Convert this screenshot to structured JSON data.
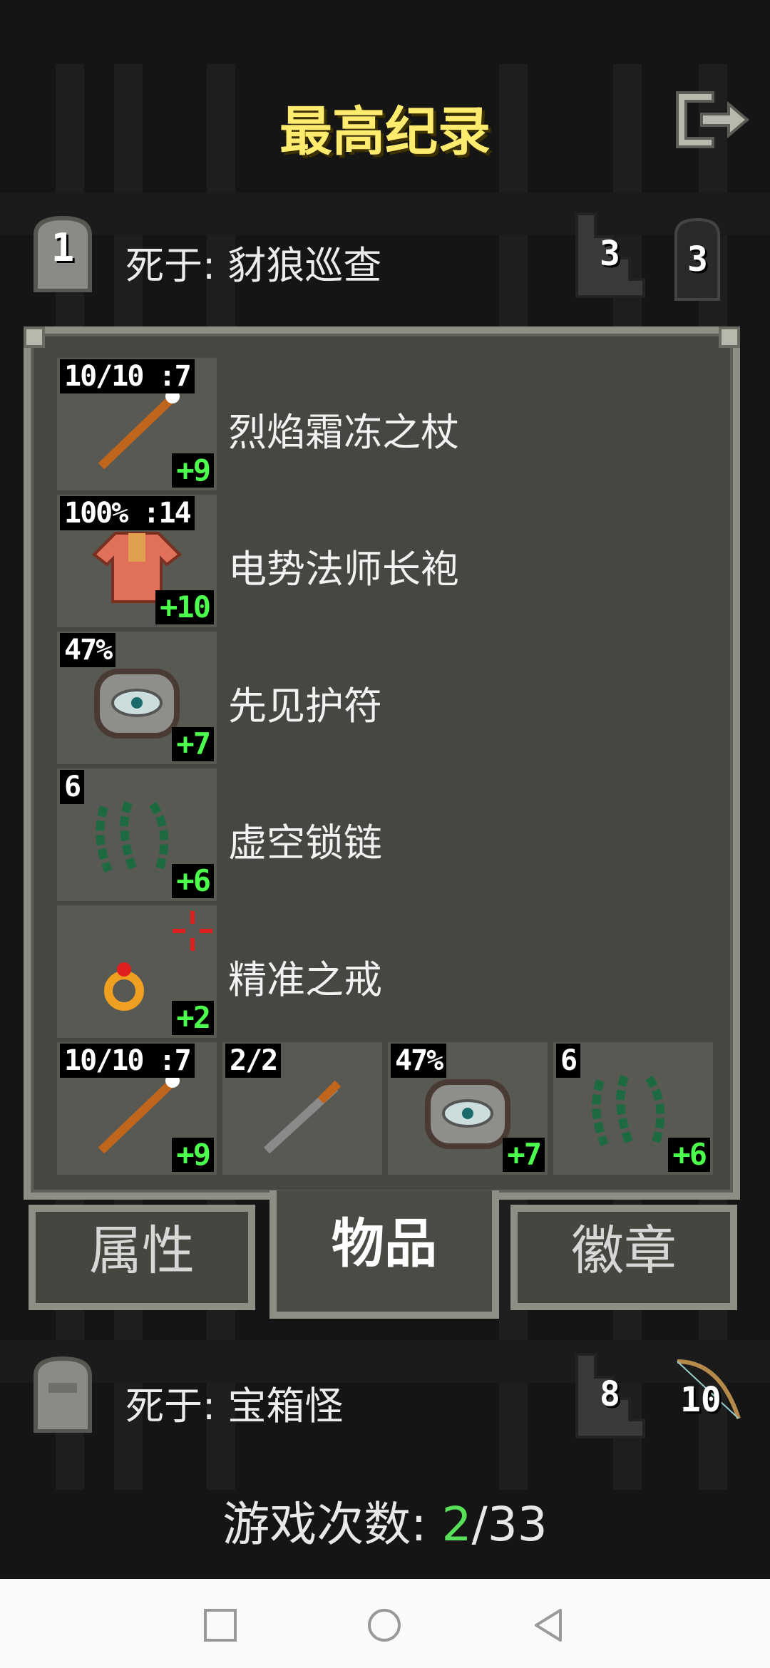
{
  "title": "最高纪录",
  "records": [
    {
      "rank": "1",
      "cause": "死于: 豺狼巡查",
      "depth": "3",
      "level": "3"
    },
    {
      "rank": "",
      "cause": "死于: 宝箱怪",
      "depth": "8",
      "level": "10"
    }
  ],
  "items": [
    {
      "name": "烈焰霜冻之杖",
      "top": "10/10 :7",
      "plus": "+9",
      "icon": "wand-icon"
    },
    {
      "name": "电势法师长袍",
      "top": "100% :14",
      "plus": "+10",
      "icon": "robe-icon"
    },
    {
      "name": "先见护符",
      "top": "47%",
      "plus": "+7",
      "icon": "amulet-icon"
    },
    {
      "name": "虚空锁链",
      "top": "6",
      "plus": "+6",
      "icon": "chain-icon"
    },
    {
      "name": "精准之戒",
      "top": "",
      "plus": "+2",
      "icon": "ring-icon"
    }
  ],
  "quickslots": [
    {
      "top": "10/10 :7",
      "plus": "+9",
      "icon": "wand-icon"
    },
    {
      "top": "2/2",
      "plus": "",
      "icon": "dart-icon"
    },
    {
      "top": "47%",
      "plus": "+7",
      "icon": "amulet-icon"
    },
    {
      "top": "6",
      "plus": "+6",
      "icon": "chain-icon"
    }
  ],
  "tabs": [
    "属性",
    "物品",
    "徽章"
  ],
  "footer": {
    "label": "游戏次数: ",
    "current": "2",
    "separator": "/",
    "total": "33"
  },
  "colors": {
    "title": "#ffec6e",
    "plus": "#4cff4c",
    "panel": "#464642",
    "border": "#8d8e84"
  }
}
